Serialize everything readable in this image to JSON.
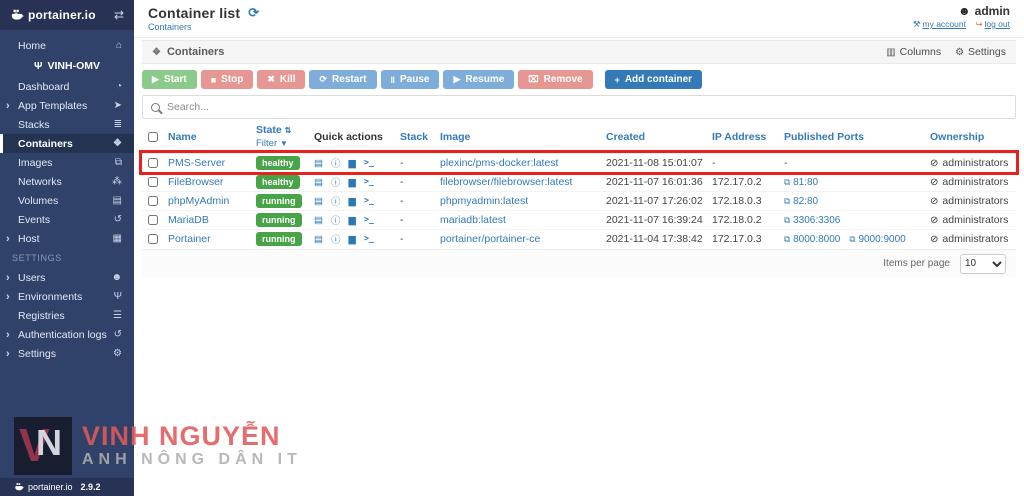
{
  "icons": {
    "collapse": "⇄",
    "home": "⌂",
    "plug": "Ψ",
    "dashboard": "◔",
    "app_templates": "➤",
    "stacks": "≣",
    "containers": "❖",
    "images": "⧉",
    "networks": "⁂",
    "volumes": "▤",
    "events": "↺",
    "host": "▦",
    "users": "☻",
    "registries": "☰",
    "auth_logs": "↺",
    "settings": "⚙",
    "chevron": "›",
    "refresh": "⟳",
    "user": "☻",
    "wrench": "⚒",
    "logout": "↪",
    "columns": "▥",
    "gear": "⚙",
    "cube": "❖",
    "sort": "⇅",
    "filter": "▼",
    "play": "▶",
    "stop": "■",
    "kill": "✖",
    "restart": "⟳",
    "pause": "‖",
    "resume": "▶",
    "remove": "⌧",
    "add": "+",
    "logs": "▤",
    "inspect": "ⓘ",
    "stats": "▆",
    "console": ">_",
    "external": "⧉",
    "eye_slash": "⊘"
  },
  "colors": {
    "accent": "#337ab7",
    "sidebar": "#30426a",
    "sidebar_dark": "#283254",
    "badge_green": "#47a447",
    "highlight_red": "#e8211d",
    "button_green": "#8cca8c",
    "button_red": "#e79793",
    "button_blue": "#7fadda",
    "watermark_red": "#e25a5a",
    "watermark_gray": "#b0aeae"
  },
  "sidebar": {
    "logo_text": "portainer.io",
    "endpoint": "VINH-OMV",
    "items": [
      {
        "label": "Home"
      },
      {
        "label": "Dashboard"
      },
      {
        "label": "App Templates"
      },
      {
        "label": "Stacks"
      },
      {
        "label": "Containers"
      },
      {
        "label": "Images"
      },
      {
        "label": "Networks"
      },
      {
        "label": "Volumes"
      },
      {
        "label": "Events"
      },
      {
        "label": "Host"
      }
    ],
    "settings_header": "SETTINGS",
    "settings_items": [
      {
        "label": "Users"
      },
      {
        "label": "Environments"
      },
      {
        "label": "Registries"
      },
      {
        "label": "Authentication logs"
      },
      {
        "label": "Settings"
      }
    ],
    "footer_brand": "portainer.io",
    "version": "2.9.2"
  },
  "header": {
    "title": "Container list",
    "breadcrumb": "Containers",
    "user": "admin",
    "my_account": "my account",
    "log_out": "log out"
  },
  "panel": {
    "title": "Containers",
    "columns_label": "Columns",
    "settings_label": "Settings"
  },
  "toolbar": {
    "start": "Start",
    "stop": "Stop",
    "kill": "Kill",
    "restart": "Restart",
    "pause": "Pause",
    "resume": "Resume",
    "remove": "Remove",
    "add_container": "Add container"
  },
  "search": {
    "placeholder": "Search..."
  },
  "table": {
    "headers": {
      "name": "Name",
      "state": "State",
      "filter": "Filter",
      "quick_actions": "Quick actions",
      "stack": "Stack",
      "image": "Image",
      "created": "Created",
      "ip": "IP Address",
      "ports": "Published Ports",
      "ownership": "Ownership"
    },
    "rows": [
      {
        "name": "PMS-Server",
        "state": "healthy",
        "stack": "-",
        "image": "plexinc/pms-docker:latest",
        "created": "2021-11-08 15:01:07",
        "ip": "-",
        "ports_dash": "-",
        "ownership": "administrators"
      },
      {
        "name": "FileBrowser",
        "state": "healthy",
        "stack": "-",
        "image": "filebrowser/filebrowser:latest",
        "created": "2021-11-07 16:01:36",
        "ip": "172.17.0.2",
        "ports": [
          "81:80"
        ],
        "ownership": "administrators"
      },
      {
        "name": "phpMyAdmin",
        "state": "running",
        "stack": "-",
        "image": "phpmyadmin:latest",
        "created": "2021-11-07 17:26:02",
        "ip": "172.18.0.3",
        "ports": [
          "82:80"
        ],
        "ownership": "administrators"
      },
      {
        "name": "MariaDB",
        "state": "running",
        "stack": "-",
        "image": "mariadb:latest",
        "created": "2021-11-07 16:39:24",
        "ip": "172.18.0.2",
        "ports": [
          "3306:3306"
        ],
        "ownership": "administrators"
      },
      {
        "name": "Portainer",
        "state": "running",
        "stack": "-",
        "image": "portainer/portainer-ce",
        "created": "2021-11-04 17:38:42",
        "ip": "172.17.0.3",
        "ports": [
          "8000:8000",
          "9000:9000"
        ],
        "ownership": "administrators"
      }
    ]
  },
  "pagination": {
    "label": "Items per page",
    "value": "10"
  },
  "watermark": {
    "line1": "VINH NGUYỄN",
    "line2": "ANH NÔNG DÂN IT",
    "monogram_v": "V",
    "monogram_n": "N"
  }
}
